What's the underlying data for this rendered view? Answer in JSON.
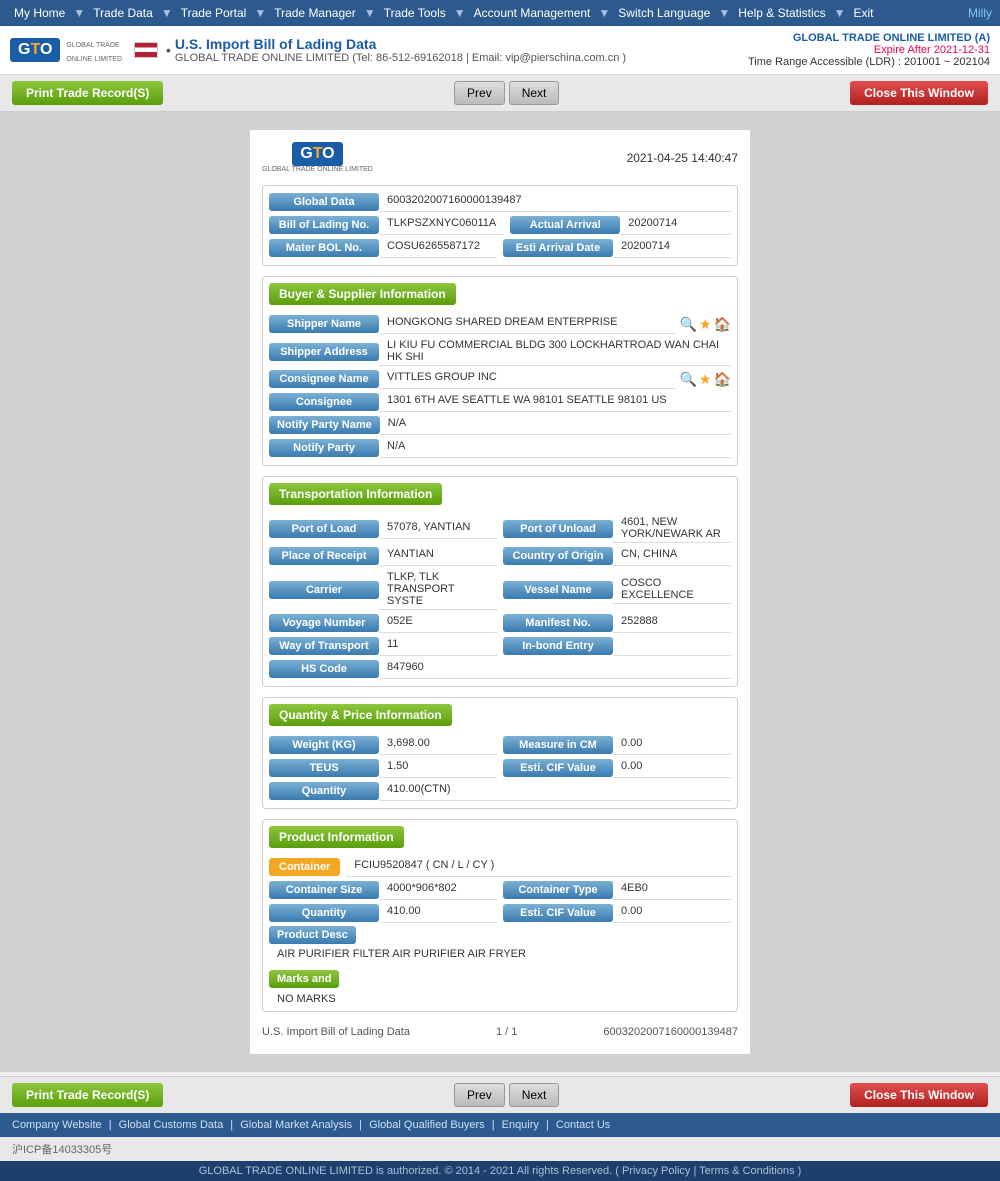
{
  "nav": {
    "items": [
      {
        "label": "My Home",
        "id": "my-home"
      },
      {
        "label": "Trade Data",
        "id": "trade-data"
      },
      {
        "label": "Trade Portal",
        "id": "trade-portal"
      },
      {
        "label": "Trade Manager",
        "id": "trade-manager"
      },
      {
        "label": "Trade Tools",
        "id": "trade-tools"
      },
      {
        "label": "Account Management",
        "id": "account-mgmt"
      },
      {
        "label": "Switch Language",
        "id": "switch-lang"
      },
      {
        "label": "Help & Statistics",
        "id": "help-stats"
      },
      {
        "label": "Exit",
        "id": "exit"
      }
    ],
    "user": "Milly"
  },
  "header": {
    "title": "U.S. Import Bill of Lading Data",
    "company_line": "GLOBAL TRADE ONLINE LIMITED (Tel: 86-512-69162018 | Email: vip@pierschina.com.cn )",
    "right_company": "GLOBAL TRADE ONLINE LIMITED (A)",
    "expire": "Expire After 2021-12-31",
    "time_range": "Time Range Accessible (LDR) : 201001 ~ 202104"
  },
  "toolbar": {
    "print_label": "Print Trade Record(S)",
    "prev_label": "Prev",
    "next_label": "Next",
    "close_label": "Close This Window"
  },
  "doc": {
    "timestamp": "2021-04-25 14:40:47",
    "global_data_label": "Global Data",
    "global_data_value": "6003202007160000139487",
    "bill_of_lading_label": "Bill of Lading No.",
    "bill_of_lading_value": "TLKPSZXNYC06011A",
    "actual_arrival_label": "Actual Arrival",
    "actual_arrival_value": "20200714",
    "master_bol_label": "Mater BOL No.",
    "master_bol_value": "COSU6265587172",
    "esti_arrival_label": "Esti Arrival Date",
    "esti_arrival_value": "20200714",
    "buyer_supplier_section": "Buyer & Supplier Information",
    "shipper_name_label": "Shipper Name",
    "shipper_name_value": "HONGKONG SHARED DREAM ENTERPRISE",
    "shipper_address_label": "Shipper Address",
    "shipper_address_value": "LI KIU FU COMMERCIAL BLDG 300 LOCKHARTROAD WAN CHAI HK SHI",
    "consignee_name_label": "Consignee Name",
    "consignee_name_value": "VITTLES GROUP INC",
    "consignee_label": "Consignee",
    "consignee_value": "1301 6TH AVE SEATTLE WA 98101 SEATTLE 98101 US",
    "notify_party_name_label": "Notify Party Name",
    "notify_party_name_value": "N/A",
    "notify_party_label": "Notify Party",
    "notify_party_value": "N/A",
    "transport_section": "Transportation Information",
    "port_of_load_label": "Port of Load",
    "port_of_load_value": "57078, YANTIAN",
    "port_of_unload_label": "Port of Unload",
    "port_of_unload_value": "4601, NEW YORK/NEWARK AR",
    "place_of_receipt_label": "Place of Receipt",
    "place_of_receipt_value": "YANTIAN",
    "country_of_origin_label": "Country of Origin",
    "country_of_origin_value": "CN, CHINA",
    "carrier_label": "Carrier",
    "carrier_value": "TLKP, TLK TRANSPORT SYSTE",
    "vessel_name_label": "Vessel Name",
    "vessel_name_value": "COSCO EXCELLENCE",
    "voyage_number_label": "Voyage Number",
    "voyage_number_value": "052E",
    "manifest_no_label": "Manifest No.",
    "manifest_no_value": "252888",
    "way_of_transport_label": "Way of Transport",
    "way_of_transport_value": "11",
    "in_bond_entry_label": "In-bond Entry",
    "in_bond_entry_value": "",
    "hs_code_label": "HS Code",
    "hs_code_value": "847960",
    "quantity_price_section": "Quantity & Price Information",
    "weight_label": "Weight (KG)",
    "weight_value": "3,698.00",
    "measure_in_cm_label": "Measure in CM",
    "measure_in_cm_value": "0.00",
    "teus_label": "TEUS",
    "teus_value": "1.50",
    "esti_cif_label": "Esti. CIF Value",
    "esti_cif_value": "0.00",
    "quantity_label": "Quantity",
    "quantity_value": "410.00(CTN)",
    "product_section": "Product Information",
    "container_badge": "Container",
    "container_value": "FCIU9520847 ( CN / L / CY )",
    "container_size_label": "Container Size",
    "container_size_value": "4000*906*802",
    "container_type_label": "Container Type",
    "container_type_value": "4EB0",
    "product_quantity_label": "Quantity",
    "product_quantity_value": "410.00",
    "product_esti_cif_label": "Esti. CIF Value",
    "product_esti_cif_value": "0.00",
    "product_desc_label": "Product Desc",
    "product_desc_value": "AIR PURIFIER FILTER AIR PURIFIER AIR FRYER",
    "marks_label": "Marks and",
    "marks_value": "NO MARKS",
    "footer_left": "U.S. Import Bill of Lading Data",
    "footer_page": "1 / 1",
    "footer_id": "6003202007160000139487"
  },
  "bottom_toolbar": {
    "print_label": "Print Trade Record(S)",
    "prev_label": "Prev",
    "next_label": "Next",
    "close_label": "Close This Window"
  },
  "footer_links": [
    {
      "label": "Company Website"
    },
    {
      "label": "Global Customs Data"
    },
    {
      "label": "Global Market Analysis"
    },
    {
      "label": "Global Qualified Buyers"
    },
    {
      "label": "Enquiry"
    },
    {
      "label": "Contact Us"
    }
  ],
  "footer_copy": "GLOBAL TRADE ONLINE LIMITED is authorized. © 2014 - 2021 All rights Reserved.  (  Privacy Policy  |  Terms & Conditions  )",
  "icp": "沪ICP备14033305号",
  "privacy_label": "Privacy Policy",
  "terms_label": "Terms & Conditions",
  "conditions_label": "Conditions"
}
